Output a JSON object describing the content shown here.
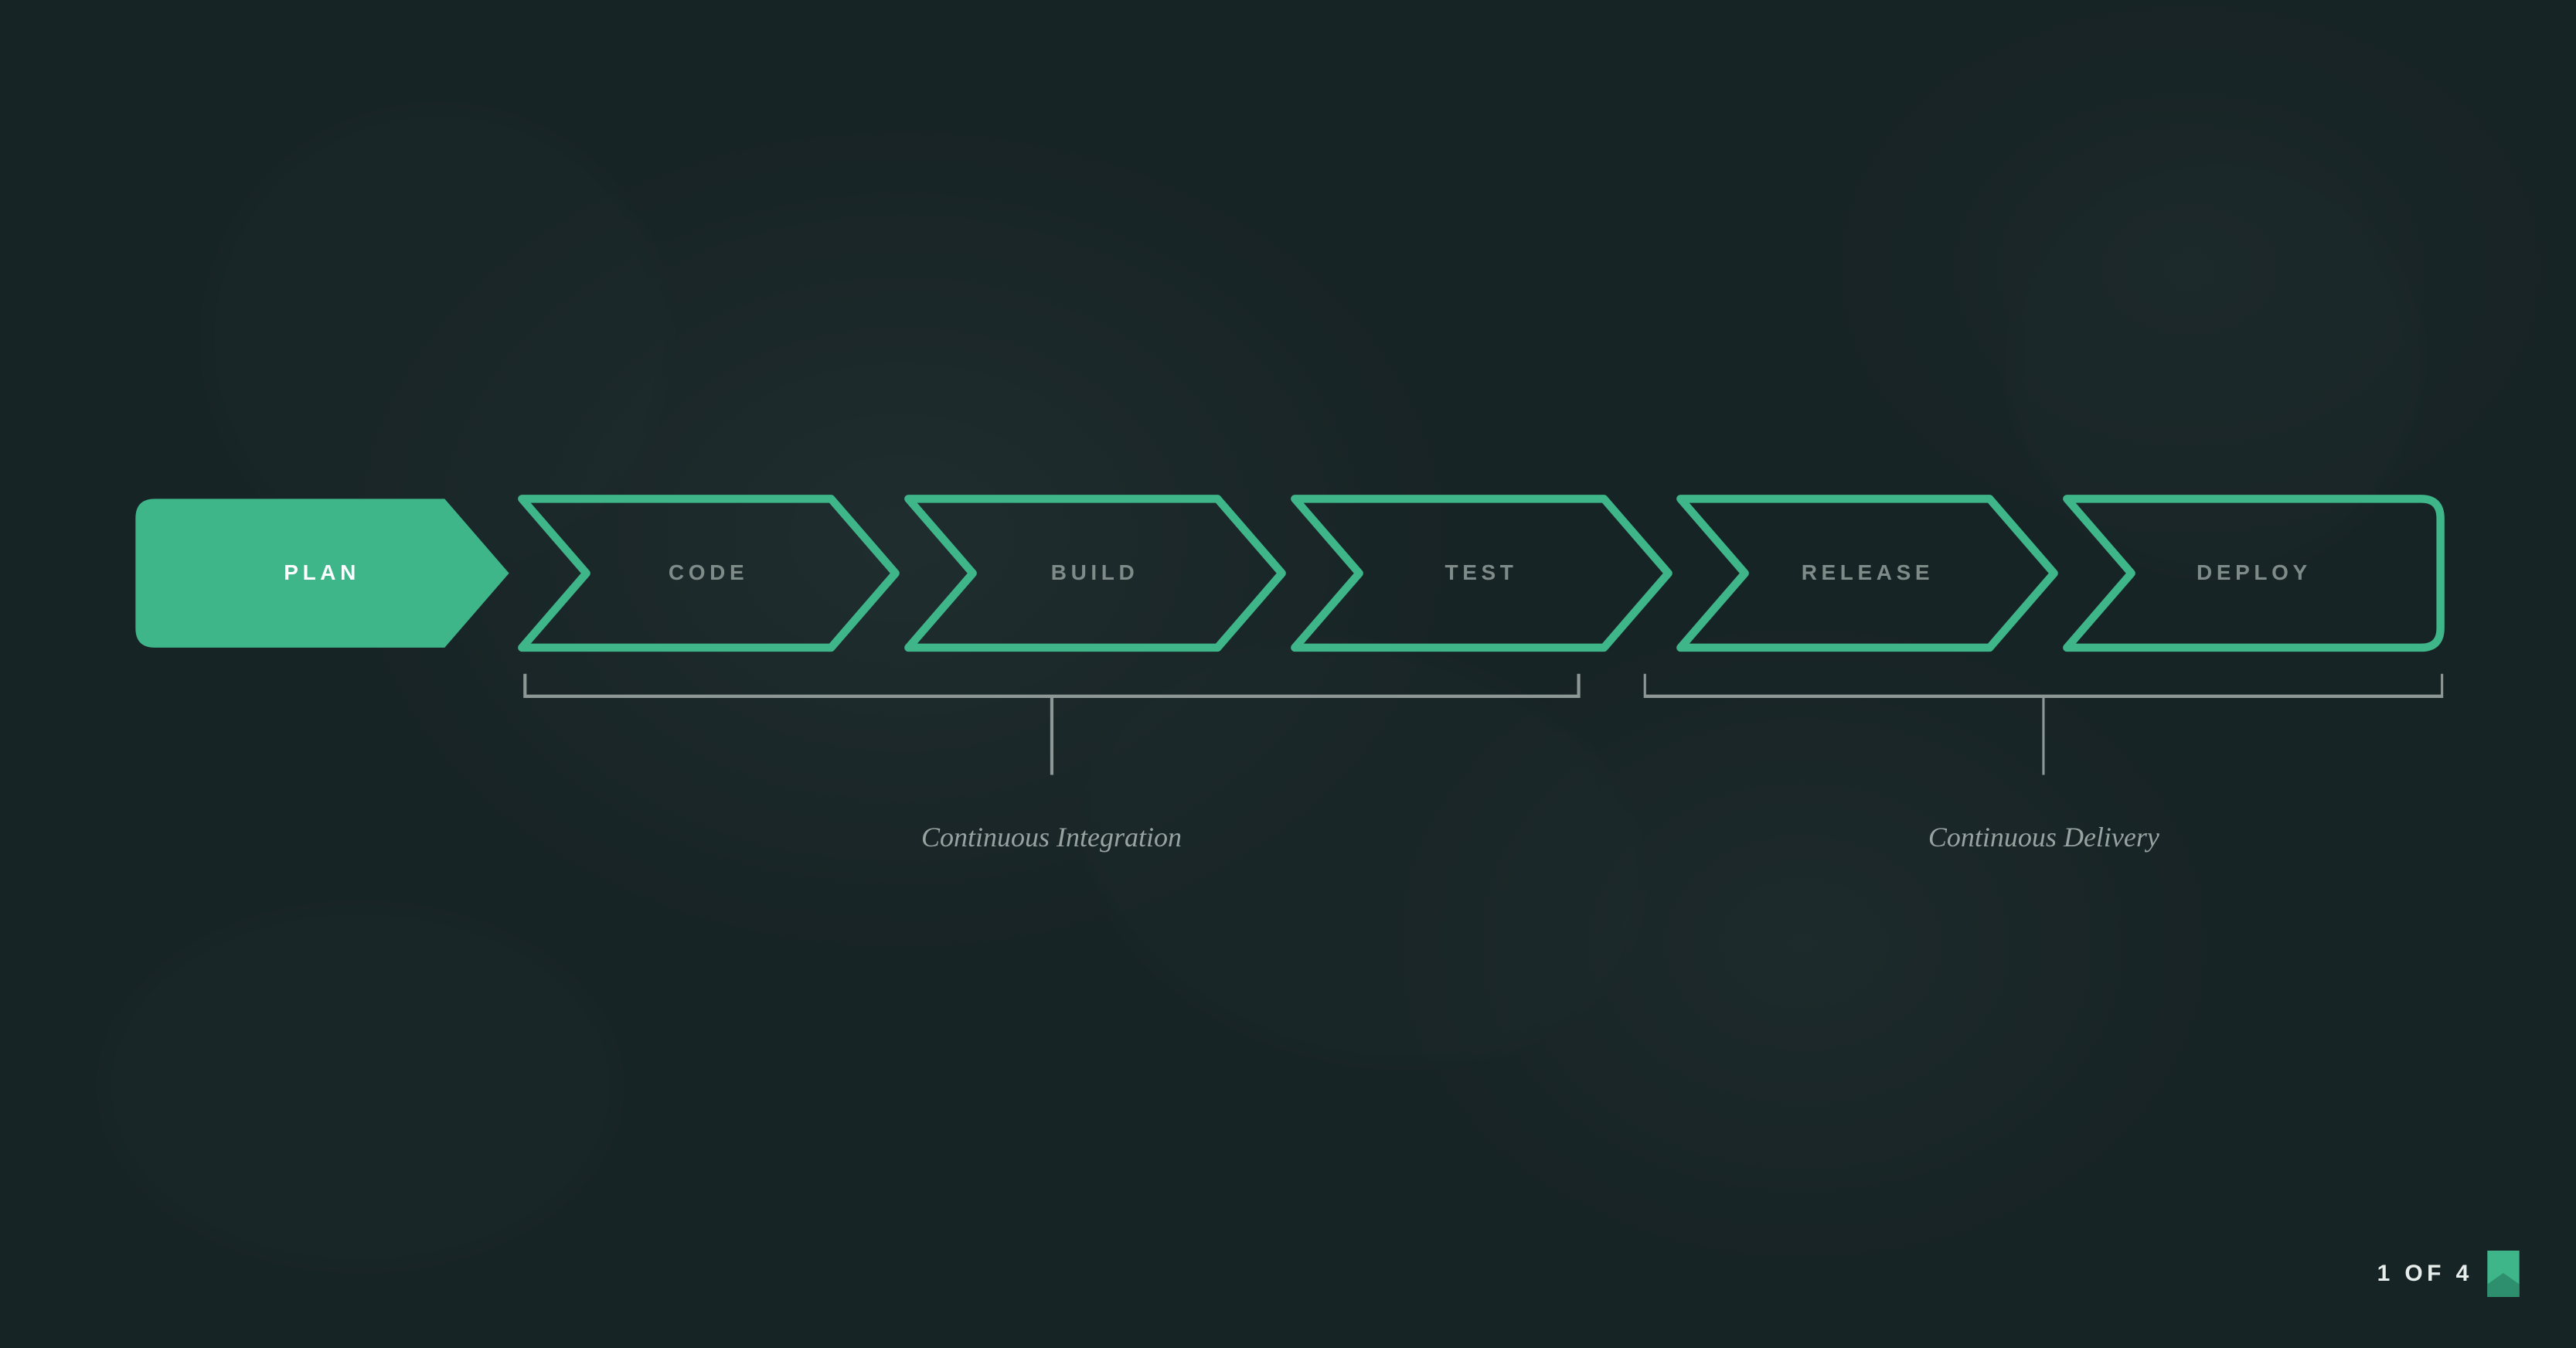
{
  "pipeline": {
    "steps": [
      {
        "label": "PLAN",
        "active": true
      },
      {
        "label": "CODE",
        "active": false
      },
      {
        "label": "BUILD",
        "active": false
      },
      {
        "label": "TEST",
        "active": false
      },
      {
        "label": "RELEASE",
        "active": false
      },
      {
        "label": "DEPLOY",
        "active": false
      }
    ]
  },
  "groups": {
    "ci": {
      "label": "Continuous Integration"
    },
    "cd": {
      "label": "Continuous Delivery"
    }
  },
  "footer": {
    "page_counter": "1 OF 4"
  },
  "colors": {
    "accent": "#3fb58a",
    "accent_dark": "#2e8f6e",
    "bg": "#1e2d2f",
    "text_muted": "#98a3a1"
  }
}
